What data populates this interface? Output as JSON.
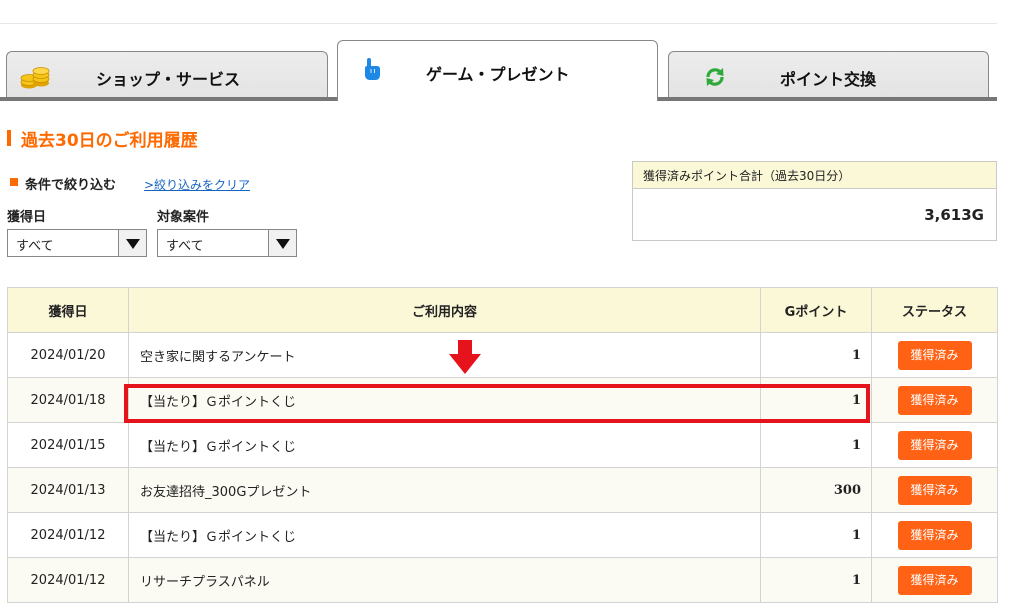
{
  "tabs": [
    {
      "label": "ショップ・サービス",
      "icon": "coins-icon"
    },
    {
      "label": "ゲーム・プレゼント",
      "icon": "pointing-hand-icon",
      "active": true
    },
    {
      "label": "ポイント交換",
      "icon": "refresh-icon"
    }
  ],
  "section": {
    "title": "過去30日のご利用履歴"
  },
  "filter": {
    "title": "条件で絞り込む",
    "clear_link": ">絞り込みをクリア",
    "date_label": "獲得日",
    "date_value": "すべて",
    "type_label": "対象案件",
    "type_value": "すべて"
  },
  "summary": {
    "label": "獲得済みポイント合計（過去30日分）",
    "value": "3,613G"
  },
  "table": {
    "headers": {
      "date": "獲得日",
      "desc": "ご利用内容",
      "points": "Gポイント",
      "status": "ステータス"
    },
    "rows": [
      {
        "date": "2024/01/20",
        "desc": "空き家に関するアンケート",
        "points": "1",
        "status": "獲得済み"
      },
      {
        "date": "2024/01/18",
        "desc": "【当たり】Ｇポイントくじ",
        "points": "1",
        "status": "獲得済み"
      },
      {
        "date": "2024/01/15",
        "desc": "【当たり】Ｇポイントくじ",
        "points": "1",
        "status": "獲得済み"
      },
      {
        "date": "2024/01/13",
        "desc": "お友達招待_300Gプレゼント",
        "points": "300",
        "status": "獲得済み"
      },
      {
        "date": "2024/01/12",
        "desc": "【当たり】Ｇポイントくじ",
        "points": "1",
        "status": "獲得済み"
      },
      {
        "date": "2024/01/12",
        "desc": "リサーチプラスパネル",
        "points": "1",
        "status": "獲得済み"
      }
    ]
  },
  "annotation": {
    "arrow_color": "#e5141c",
    "highlight_color": "#e5141c"
  },
  "colors": {
    "accent": "#ff6a00",
    "button": "#ff6215",
    "header_bg": "#fbf8d8",
    "link": "#1565c0"
  }
}
